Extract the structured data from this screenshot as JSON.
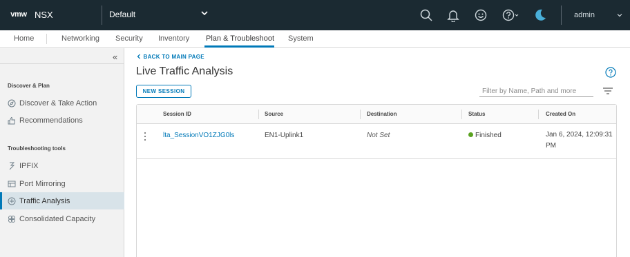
{
  "header": {
    "logo": "vmw",
    "product": "NSX",
    "project": "Default",
    "user": "admin",
    "icons": [
      "search-icon",
      "bell-icon",
      "smiley-icon",
      "help-icon",
      "moon-icon"
    ]
  },
  "nav": {
    "tabs": [
      "Home",
      "Networking",
      "Security",
      "Inventory",
      "Plan & Troubleshoot",
      "System"
    ],
    "active": "Plan & Troubleshoot"
  },
  "sidebar": {
    "collapse": "«",
    "groups": [
      {
        "title": "Discover & Plan",
        "items": [
          {
            "label": "Discover & Take Action",
            "icon": "compass-icon"
          },
          {
            "label": "Recommendations",
            "icon": "thumbs-up-icon"
          }
        ]
      },
      {
        "title": "Troubleshooting tools",
        "items": [
          {
            "label": "IPFIX",
            "icon": "ipfix-icon"
          },
          {
            "label": "Port Mirroring",
            "icon": "port-mirroring-icon"
          },
          {
            "label": "Traffic Analysis",
            "icon": "traffic-analysis-icon",
            "active": true
          },
          {
            "label": "Consolidated Capacity",
            "icon": "capacity-icon"
          }
        ]
      }
    ]
  },
  "main": {
    "back_link": "BACK TO MAIN PAGE",
    "title": "Live Traffic Analysis",
    "new_session": "NEW SESSION",
    "filter_placeholder": "Filter by Name, Path and more",
    "table": {
      "columns": [
        "Session ID",
        "Source",
        "Destination",
        "Status",
        "Created On"
      ],
      "rows": [
        {
          "session_id": "lta_SessionVO1ZJG0ls",
          "source": "EN1-Uplink1",
          "destination": "Not Set",
          "status": "Finished",
          "created_on": "Jan 6, 2024, 12:09:31 PM"
        }
      ]
    }
  },
  "colors": {
    "header_bg": "#1b2a32",
    "accent": "#0079b8",
    "status_finished": "#5aa220"
  }
}
